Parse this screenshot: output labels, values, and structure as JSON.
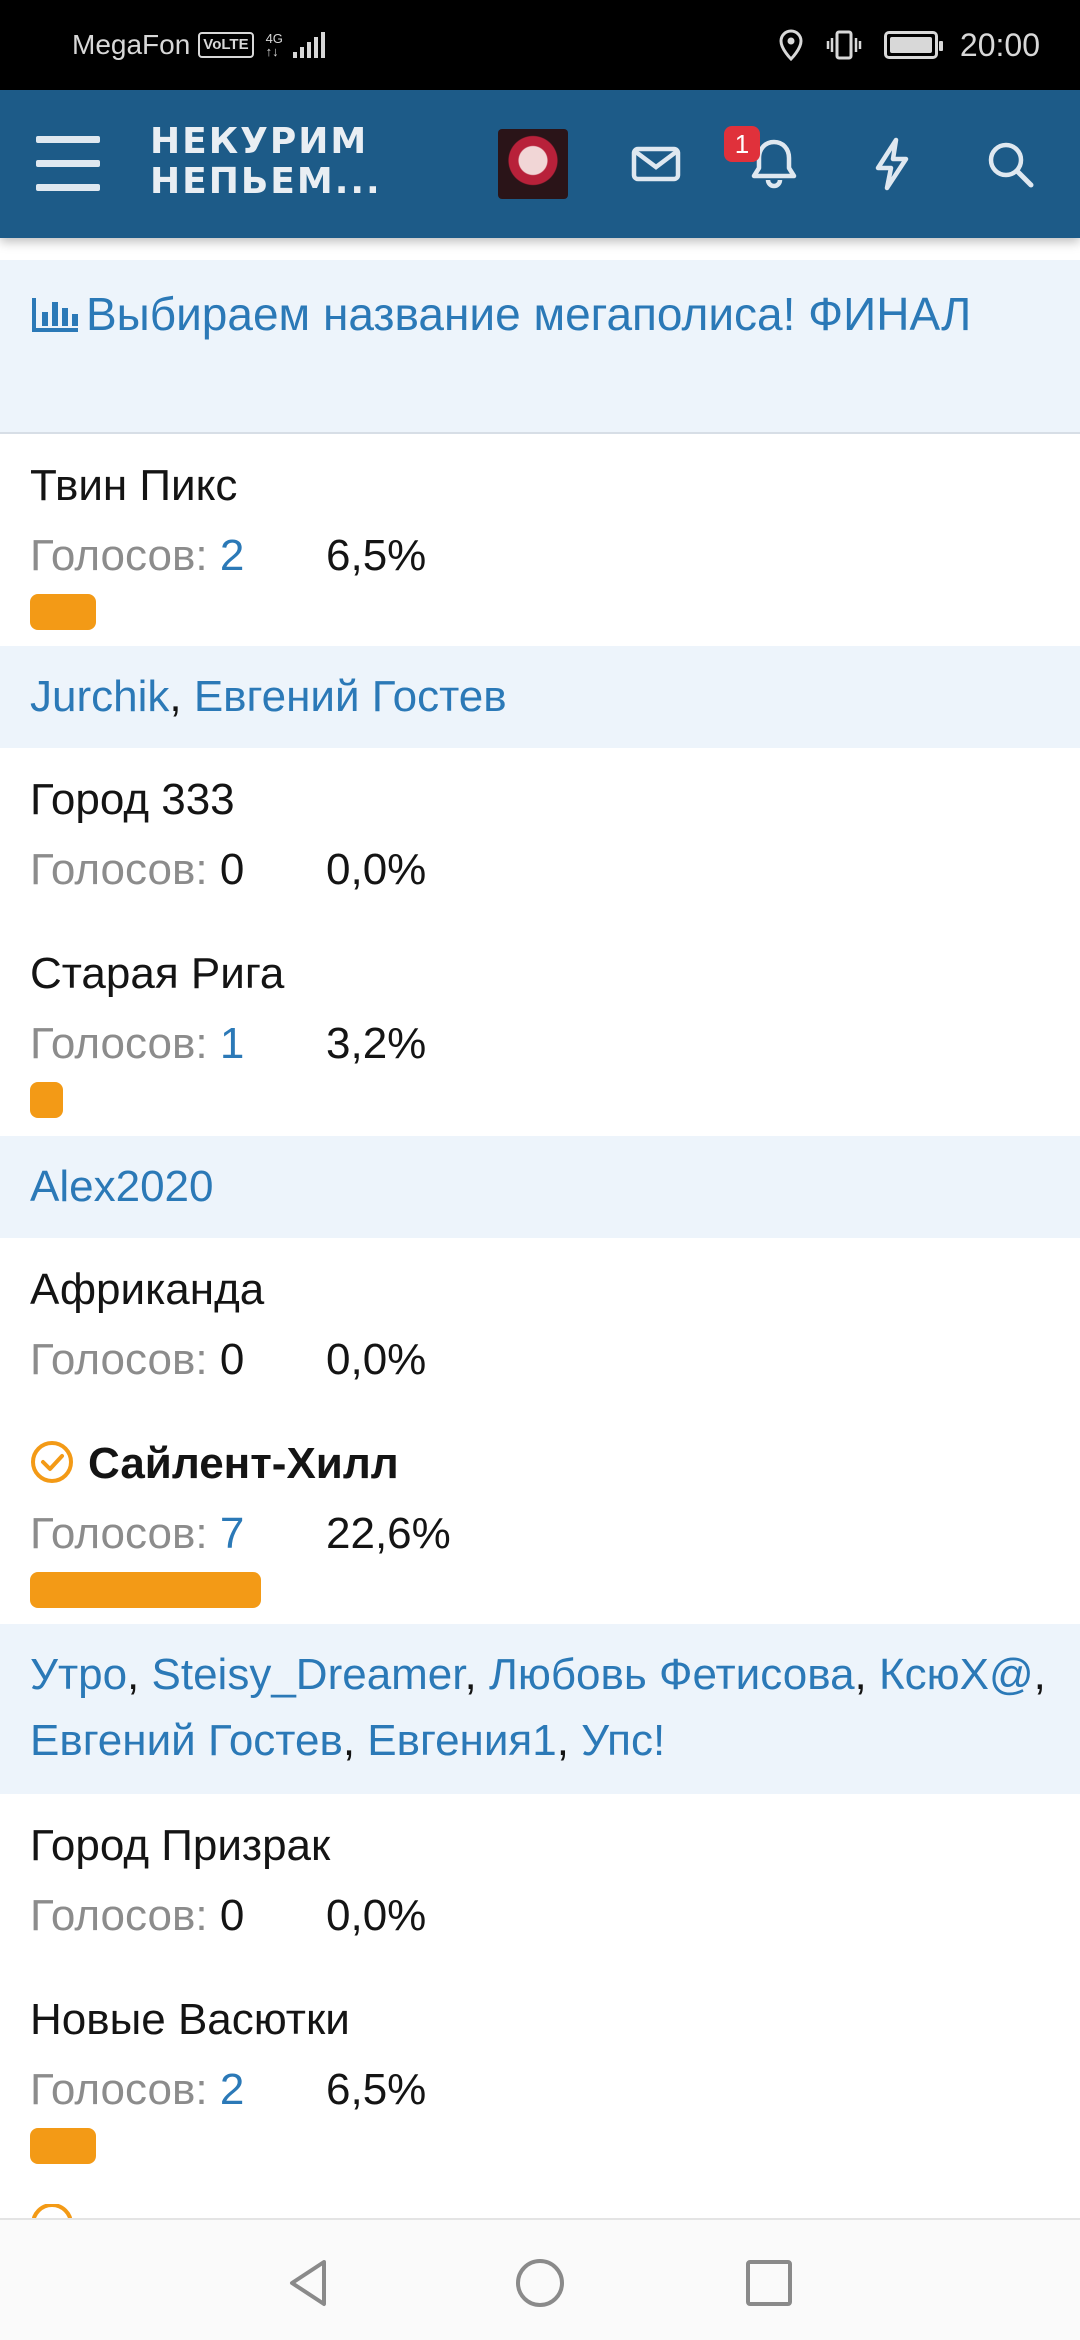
{
  "status_bar": {
    "carrier": "MegaFon",
    "volte": "VoLTE",
    "network": "4G",
    "time": "20:00"
  },
  "app_bar": {
    "logo_line1": "НЕКУРИМ",
    "logo_line2": "НЕПЬЕМ...",
    "notification_count": "1"
  },
  "poll": {
    "title": "Выбираем название мегаполиса! ФИНАЛ",
    "votes_label": "Голосов:",
    "options": [
      {
        "name": "Твин Пикс",
        "votes": "2",
        "percent": "6,5%",
        "share": 6.5
      },
      {
        "name": "Город 333",
        "votes": "0",
        "percent": "0,0%",
        "share": 0
      },
      {
        "name": "Старая Рига",
        "votes": "1",
        "percent": "3,2%",
        "share": 3.2
      },
      {
        "name": "Африканда",
        "votes": "0",
        "percent": "0,0%",
        "share": 0
      },
      {
        "name": "Сайлент-Хилл",
        "votes": "7",
        "percent": "22,6%",
        "share": 22.6,
        "voted": true
      },
      {
        "name": "Город Призрак",
        "votes": "0",
        "percent": "0,0%",
        "share": 0
      },
      {
        "name": "Новые Васютки",
        "votes": "2",
        "percent": "6,5%",
        "share": 6.5
      }
    ],
    "voters_twin_peaks": [
      "Jurchik",
      "Евгений Гостев"
    ],
    "voters_old_riga": [
      "Alex2020"
    ],
    "voters_silent_hill": [
      "Утро",
      "Steisy_Dreamer",
      "Любовь Фетисова",
      "КсюХ@",
      "Евгений Гостев",
      "Евгения1",
      "Упс!"
    ]
  },
  "colors": {
    "header": "#1d5b88",
    "link": "#2b79b7",
    "bar": "#f39a16",
    "voters_bg": "#edf4fb"
  }
}
